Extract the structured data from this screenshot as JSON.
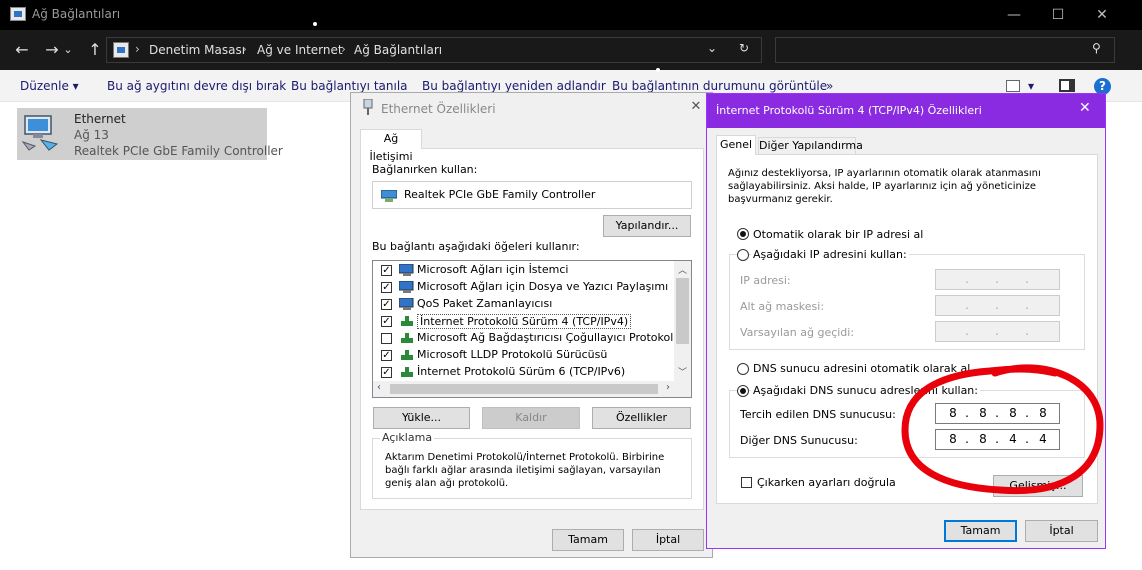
{
  "window": {
    "title": "Ağ Bağlantıları",
    "minimize_glyph": "—",
    "maximize_glyph": "☐",
    "close_glyph": "✕"
  },
  "addressbar": {
    "back_glyph": "←",
    "forward_glyph": "→",
    "recent_glyph": "⌄",
    "up_glyph": "↑",
    "crumbs": [
      "Denetim Masası",
      "Ağ ve Internet",
      "Ağ Bağlantıları"
    ],
    "separator": "›",
    "dropdown_glyph": "⌄",
    "refresh_glyph": "↻",
    "search_placeholder": "",
    "search_icon_glyph": "⚲"
  },
  "commandbar": {
    "items": [
      "Düzenle ▾",
      "Bu ağ aygıtını devre dışı bırak",
      "Bu bağlantıyı tanıla",
      "Bu bağlantıyı yeniden adlandır",
      "Bu bağlantının durumunu görüntüle",
      "»"
    ],
    "view_glyph": "▾",
    "help_glyph": "?"
  },
  "connection": {
    "name": "Ethernet",
    "network": "Ağ 13",
    "adapter": "Realtek PCIe GbE Family Controller"
  },
  "eth_dialog": {
    "title": "Ethernet Özellikleri",
    "close_glyph": "✕",
    "tab": "Ağ İletişimi",
    "connect_using_label": "Bağlanırken kullan:",
    "adapter": "Realtek PCIe GbE Family Controller",
    "configure_button": "Yapılandır...",
    "items_label": "Bu bağlantı aşağıdaki öğeleri kullanır:",
    "items": [
      {
        "label": "Microsoft Ağları için İstemci",
        "checked": true
      },
      {
        "label": "Microsoft Ağları için Dosya ve Yazıcı Paylaşımı",
        "checked": true
      },
      {
        "label": "QoS Paket Zamanlayıcısı",
        "checked": true
      },
      {
        "label": "İnternet Protokolü Sürüm 4 (TCP/IPv4)",
        "checked": true
      },
      {
        "label": "Microsoft Ağ Bağdaştırıcısı Çoğullayıcı Protokolü",
        "checked": false
      },
      {
        "label": "Microsoft LLDP Protokolü Sürücüsü",
        "checked": true
      },
      {
        "label": "İnternet Protokolü Sürüm 6 (TCP/IPv6)",
        "checked": true
      }
    ],
    "install_button": "Yükle...",
    "uninstall_button": "Kaldır",
    "properties_button": "Özellikler",
    "description_title": "Açıklama",
    "description_text": "Aktarım Denetimi Protokolü/İnternet Protokolü. Birbirine bağlı farklı ağlar arasında iletişimi sağlayan, varsayılan geniş alan ağı protokolü.",
    "ok_button": "Tamam",
    "cancel_button": "İptal"
  },
  "ip_dialog": {
    "title": "İnternet Protokolü Sürüm 4 (TCP/IPv4) Özellikleri",
    "close_glyph": "✕",
    "tabs": [
      "Genel",
      "Diğer Yapılandırma"
    ],
    "intro": "Ağınız destekliyorsa, IP ayarlarının otomatik olarak atanmasını sağlayabilirsiniz. Aksi halde, IP ayarlarınız için ağ yöneticinize başvurmanız gerekir.",
    "auto_ip": "Otomatik olarak bir IP adresi al",
    "manual_ip": "Aşağıdaki IP adresini kullan:",
    "ip_address_label": "IP adresi:",
    "subnet_label": "Alt ağ maskesi:",
    "gateway_label": "Varsayılan ağ geçidi:",
    "auto_dns": "DNS sunucu adresini otomatik olarak al",
    "manual_dns": "Aşağıdaki DNS sunucu adreslerini kullan:",
    "preferred_dns_label": "Tercih edilen DNS sunucusu:",
    "alternate_dns_label": "Diğer DNS Sunucusu:",
    "preferred_dns": [
      "8",
      "8",
      "8",
      "8"
    ],
    "alternate_dns": [
      "8",
      "8",
      "4",
      "4"
    ],
    "validate_on_exit": "Çıkarken ayarları doğrula",
    "advanced_button": "Gelişmiş...",
    "ok_button": "Tamam",
    "cancel_button": "İptal",
    "auto_ip_selected": true,
    "manual_dns_selected": true,
    "validate_checked": false
  },
  "annotation": {
    "color": "#e8000b",
    "shape": "hand-drawn circle around DNS fields"
  }
}
